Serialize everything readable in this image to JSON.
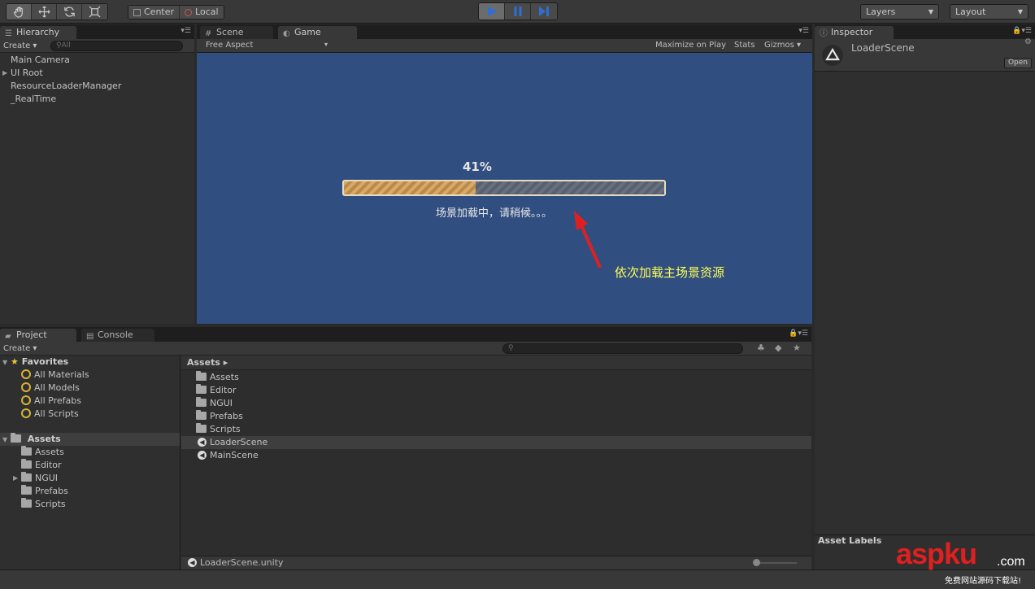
{
  "toolbar": {
    "tools": [
      "hand-tool-icon",
      "move-tool-icon",
      "rotate-tool-icon",
      "scale-tool-icon"
    ],
    "pivot": "Center",
    "space": "Local",
    "layers": "Layers",
    "layout": "Layout"
  },
  "hierarchy": {
    "tab": "Hierarchy",
    "create": "Create",
    "search_placeholder": "All",
    "items": [
      {
        "label": "Main Camera"
      },
      {
        "label": "UI Root"
      },
      {
        "label": "ResourceLoaderManager"
      },
      {
        "label": "_RealTime"
      }
    ]
  },
  "tabs": {
    "scene": "Scene",
    "game": "Game"
  },
  "game": {
    "aspect": "Free Aspect",
    "maximize": "Maximize on Play",
    "stats": "Stats",
    "gizmos": "Gizmos",
    "progress_percent": "41%",
    "progress_value": 0.41,
    "loading_text": "场景加载中，请稍候。。。",
    "annotation": "依次加载主场景资源",
    "colors": {
      "background": "#314e80",
      "annotation": "#ffff55",
      "arrow": "#e02020"
    }
  },
  "inspector": {
    "tab": "Inspector",
    "title": "LoaderScene",
    "open": "Open",
    "asset_label": "Asset Labels"
  },
  "project": {
    "tab_project": "Project",
    "tab_console": "Console",
    "create": "Create",
    "favorites": "Favorites",
    "favorite_items": [
      "All Materials",
      "All Models",
      "All Prefabs",
      "All Scripts"
    ],
    "assets_header": "Assets",
    "asset_folders": [
      "Assets",
      "Editor",
      "NGUI",
      "Prefabs",
      "Scripts"
    ],
    "breadcrumb": "Assets ▸",
    "files": [
      {
        "name": "Assets",
        "kind": "folder"
      },
      {
        "name": "Editor",
        "kind": "folder"
      },
      {
        "name": "NGUI",
        "kind": "folder"
      },
      {
        "name": "Prefabs",
        "kind": "folder"
      },
      {
        "name": "Scripts",
        "kind": "folder"
      },
      {
        "name": "LoaderScene",
        "kind": "scene"
      },
      {
        "name": "MainScene",
        "kind": "scene"
      }
    ],
    "status_file": "LoaderScene.unity"
  },
  "watermark": {
    "brand": "aspku",
    "suffix": ".com",
    "tagline": "免费网站源码下载站!"
  }
}
